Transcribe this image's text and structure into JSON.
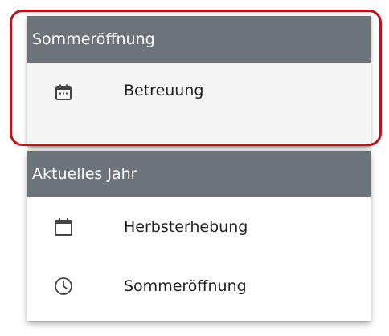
{
  "top_section": {
    "header": "Sommeröffnung",
    "items": [
      {
        "label": "Betreuung",
        "icon": "calendar-dots-icon",
        "active": true
      }
    ]
  },
  "bottom_section": {
    "header": "Aktuelles Jahr",
    "items": [
      {
        "label": "Herbsterhebung",
        "icon": "calendar-icon"
      },
      {
        "label": "Sommeröffnung",
        "icon": "clock-icon"
      }
    ]
  },
  "colors": {
    "header_bg": "#6c737a",
    "active_item_bg": "#f4f4f4",
    "highlight_frame": "#c0101a"
  }
}
